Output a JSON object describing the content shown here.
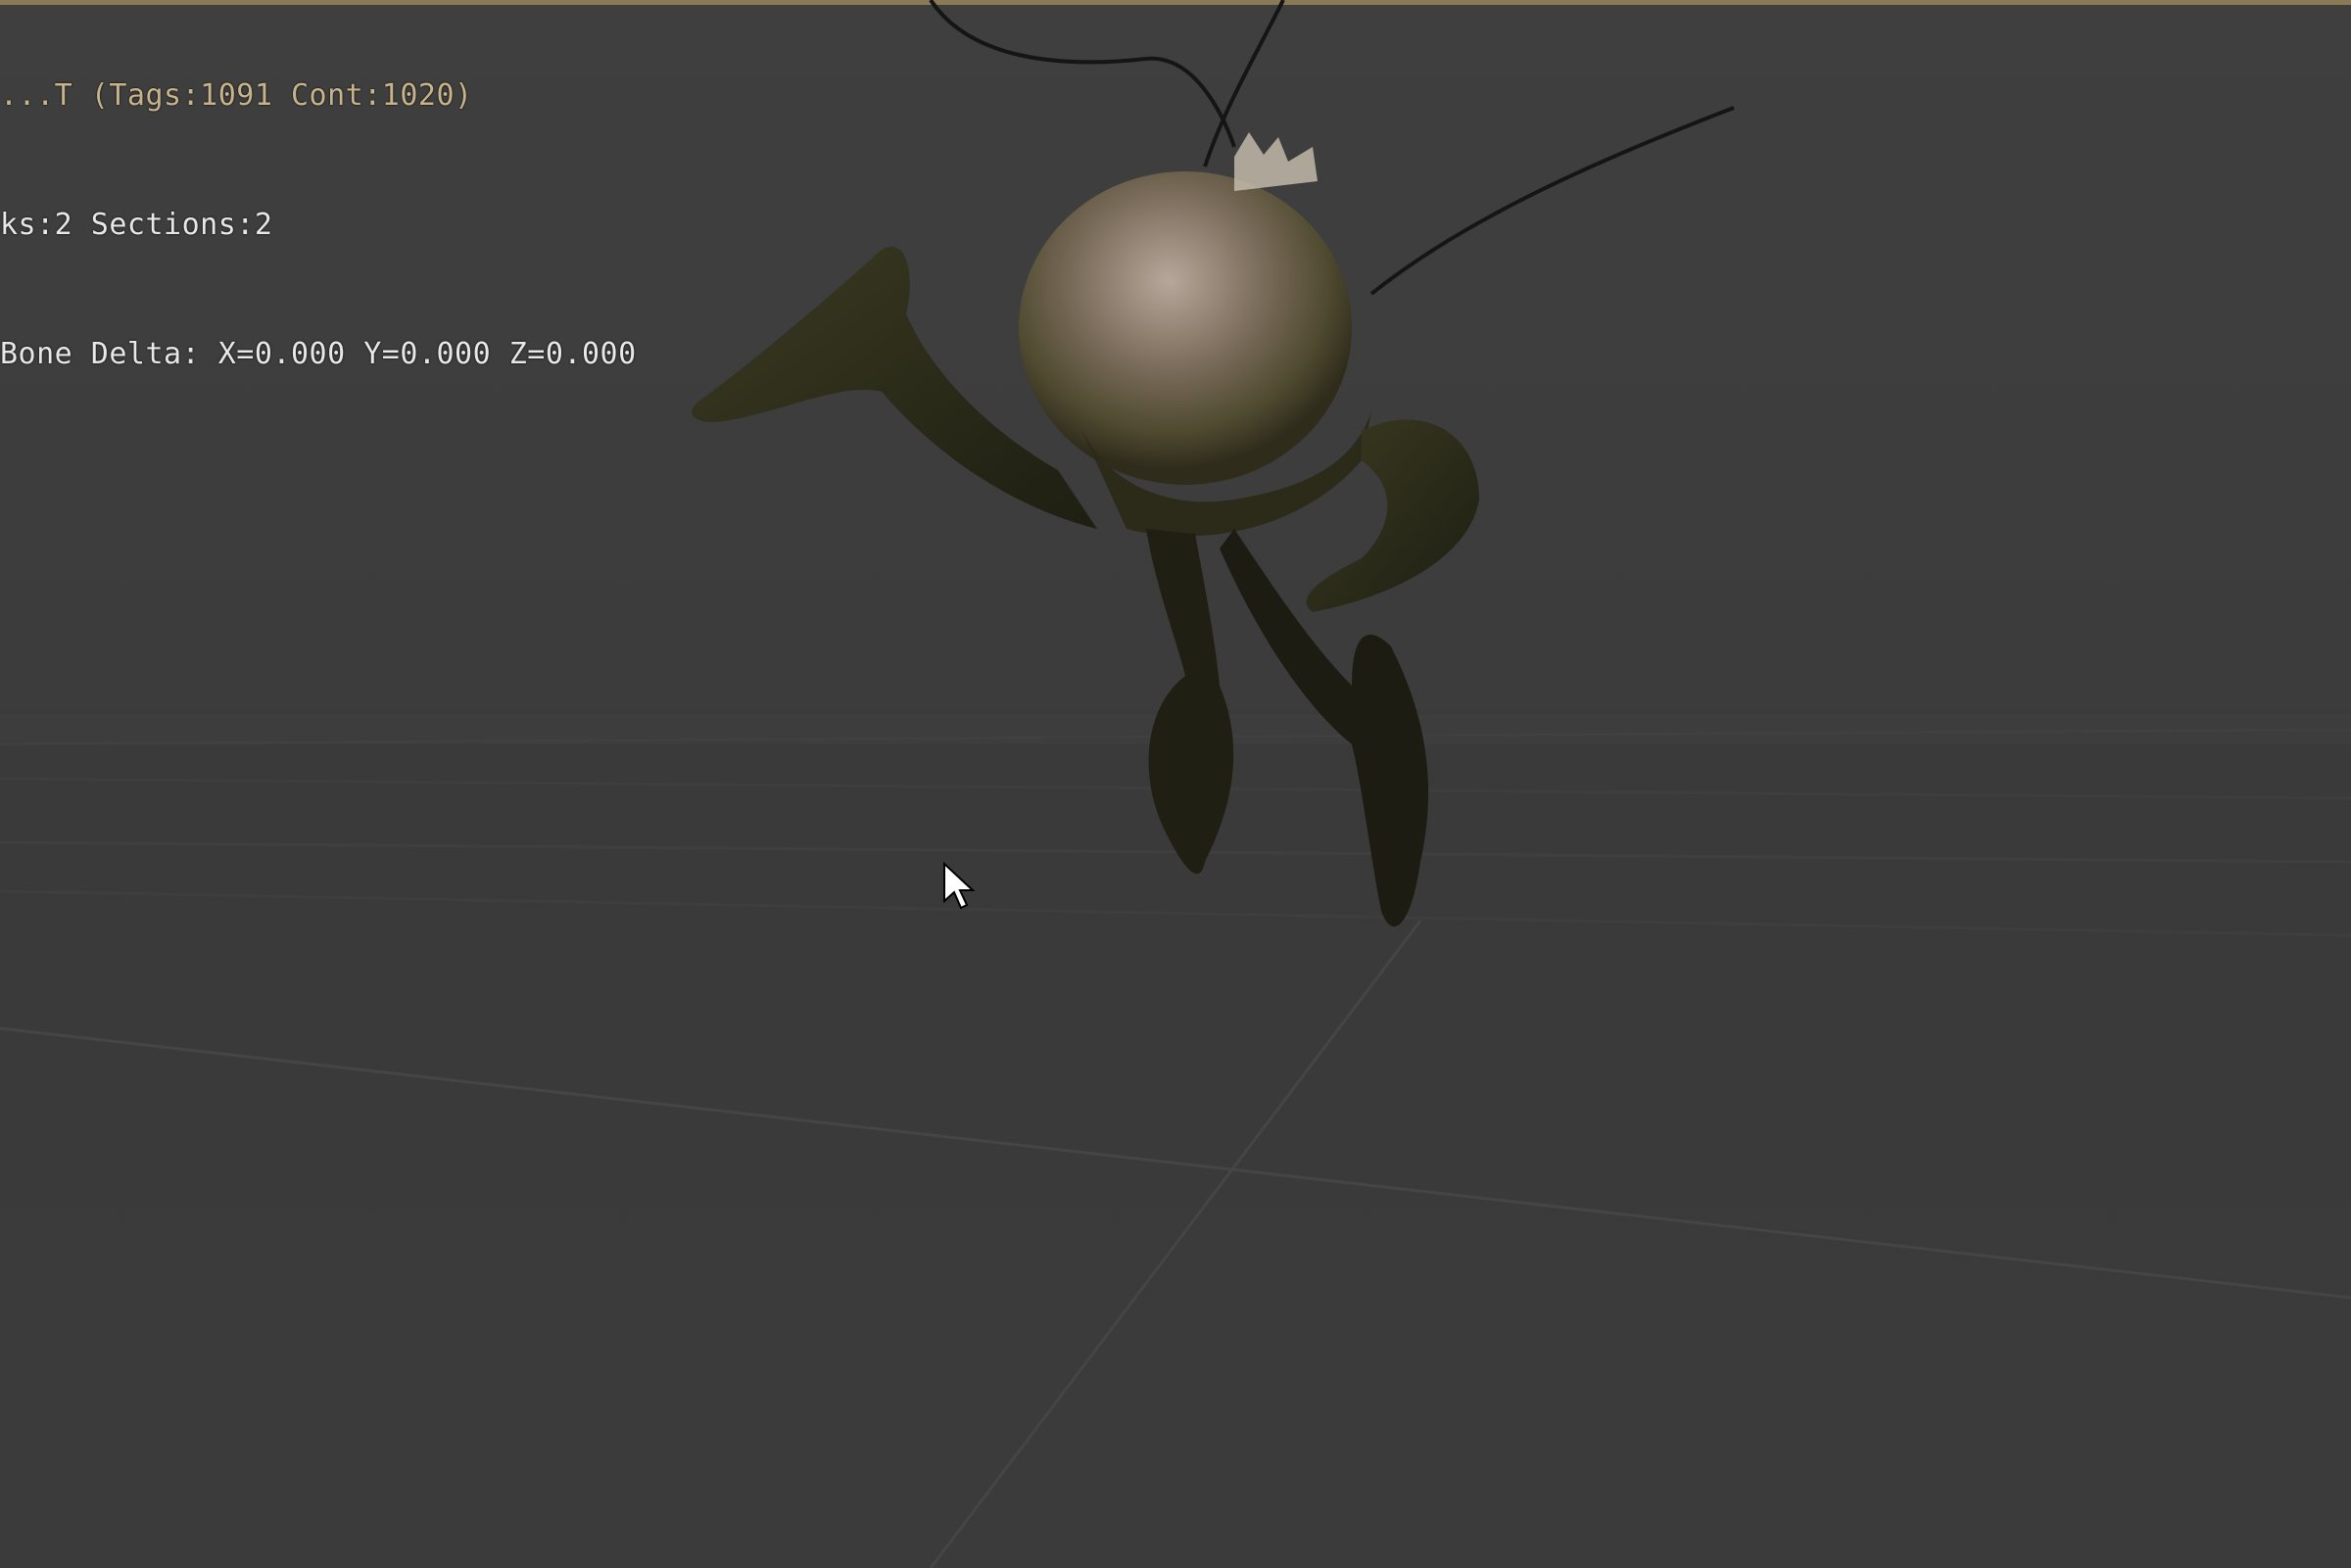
{
  "viewport": {
    "info_lines": [
      "...T (Tags:1091 Cont:1020)",
      "ks:2 Sections:2",
      "Bone Delta: X=0.000 Y=0.000 Z=0.000"
    ]
  },
  "colors": {
    "background": "#3c3c3c",
    "floor_grid": "#4a4a4a",
    "overlay_text": "#e8e8e8",
    "window_border": "#8a7a55"
  },
  "icons": {
    "cursor": "mouse-pointer-icon"
  }
}
